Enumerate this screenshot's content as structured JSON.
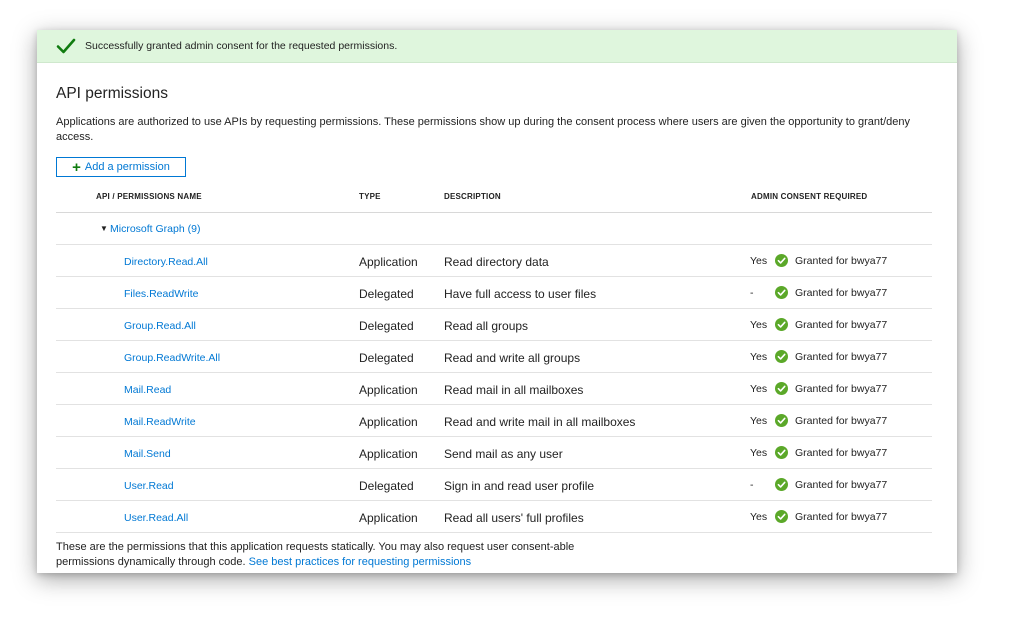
{
  "banner": {
    "icon": "checkmark-icon",
    "message": "Successfully granted admin consent for the requested permissions."
  },
  "page": {
    "title": "API permissions",
    "description": "Applications are authorized to use APIs by requesting permissions. These permissions show up during the consent process where users are given the opportunity to grant/deny access."
  },
  "toolbar": {
    "add_icon": "plus-icon",
    "add_label": "Add a permission"
  },
  "table": {
    "headers": {
      "name": "API / PERMISSIONS NAME",
      "type": "TYPE",
      "description": "DESCRIPTION",
      "admin_consent": "ADMIN CONSENT REQUIRED"
    },
    "group": {
      "icon": "caret-down-icon",
      "label": "Microsoft Graph (9)"
    },
    "rows": [
      {
        "name": "Directory.Read.All",
        "type": "Application",
        "description": "Read directory data",
        "admin": "Yes",
        "status": "Granted for bwya77"
      },
      {
        "name": "Files.ReadWrite",
        "type": "Delegated",
        "description": "Have full access to user files",
        "admin": "-",
        "status": "Granted for bwya77"
      },
      {
        "name": "Group.Read.All",
        "type": "Delegated",
        "description": "Read all groups",
        "admin": "Yes",
        "status": "Granted for bwya77"
      },
      {
        "name": "Group.ReadWrite.All",
        "type": "Delegated",
        "description": "Read and write all groups",
        "admin": "Yes",
        "status": "Granted for bwya77"
      },
      {
        "name": "Mail.Read",
        "type": "Application",
        "description": "Read mail in all mailboxes",
        "admin": "Yes",
        "status": "Granted for bwya77"
      },
      {
        "name": "Mail.ReadWrite",
        "type": "Application",
        "description": "Read and write mail in all mailboxes",
        "admin": "Yes",
        "status": "Granted for bwya77"
      },
      {
        "name": "Mail.Send",
        "type": "Application",
        "description": "Send mail as any user",
        "admin": "Yes",
        "status": "Granted for bwya77"
      },
      {
        "name": "User.Read",
        "type": "Delegated",
        "description": "Sign in and read user profile",
        "admin": "-",
        "status": "Granted for bwya77"
      },
      {
        "name": "User.Read.All",
        "type": "Application",
        "description": "Read all users' full profiles",
        "admin": "Yes",
        "status": "Granted for bwya77"
      }
    ]
  },
  "footer": {
    "text": "These are the permissions that this application requests statically. You may also request user consent-able permissions dynamically through code.",
    "link": "See best practices for requesting permissions"
  },
  "colors": {
    "accent": "#0078d4",
    "success": "#107c10",
    "banner_bg": "#dff6dd"
  }
}
